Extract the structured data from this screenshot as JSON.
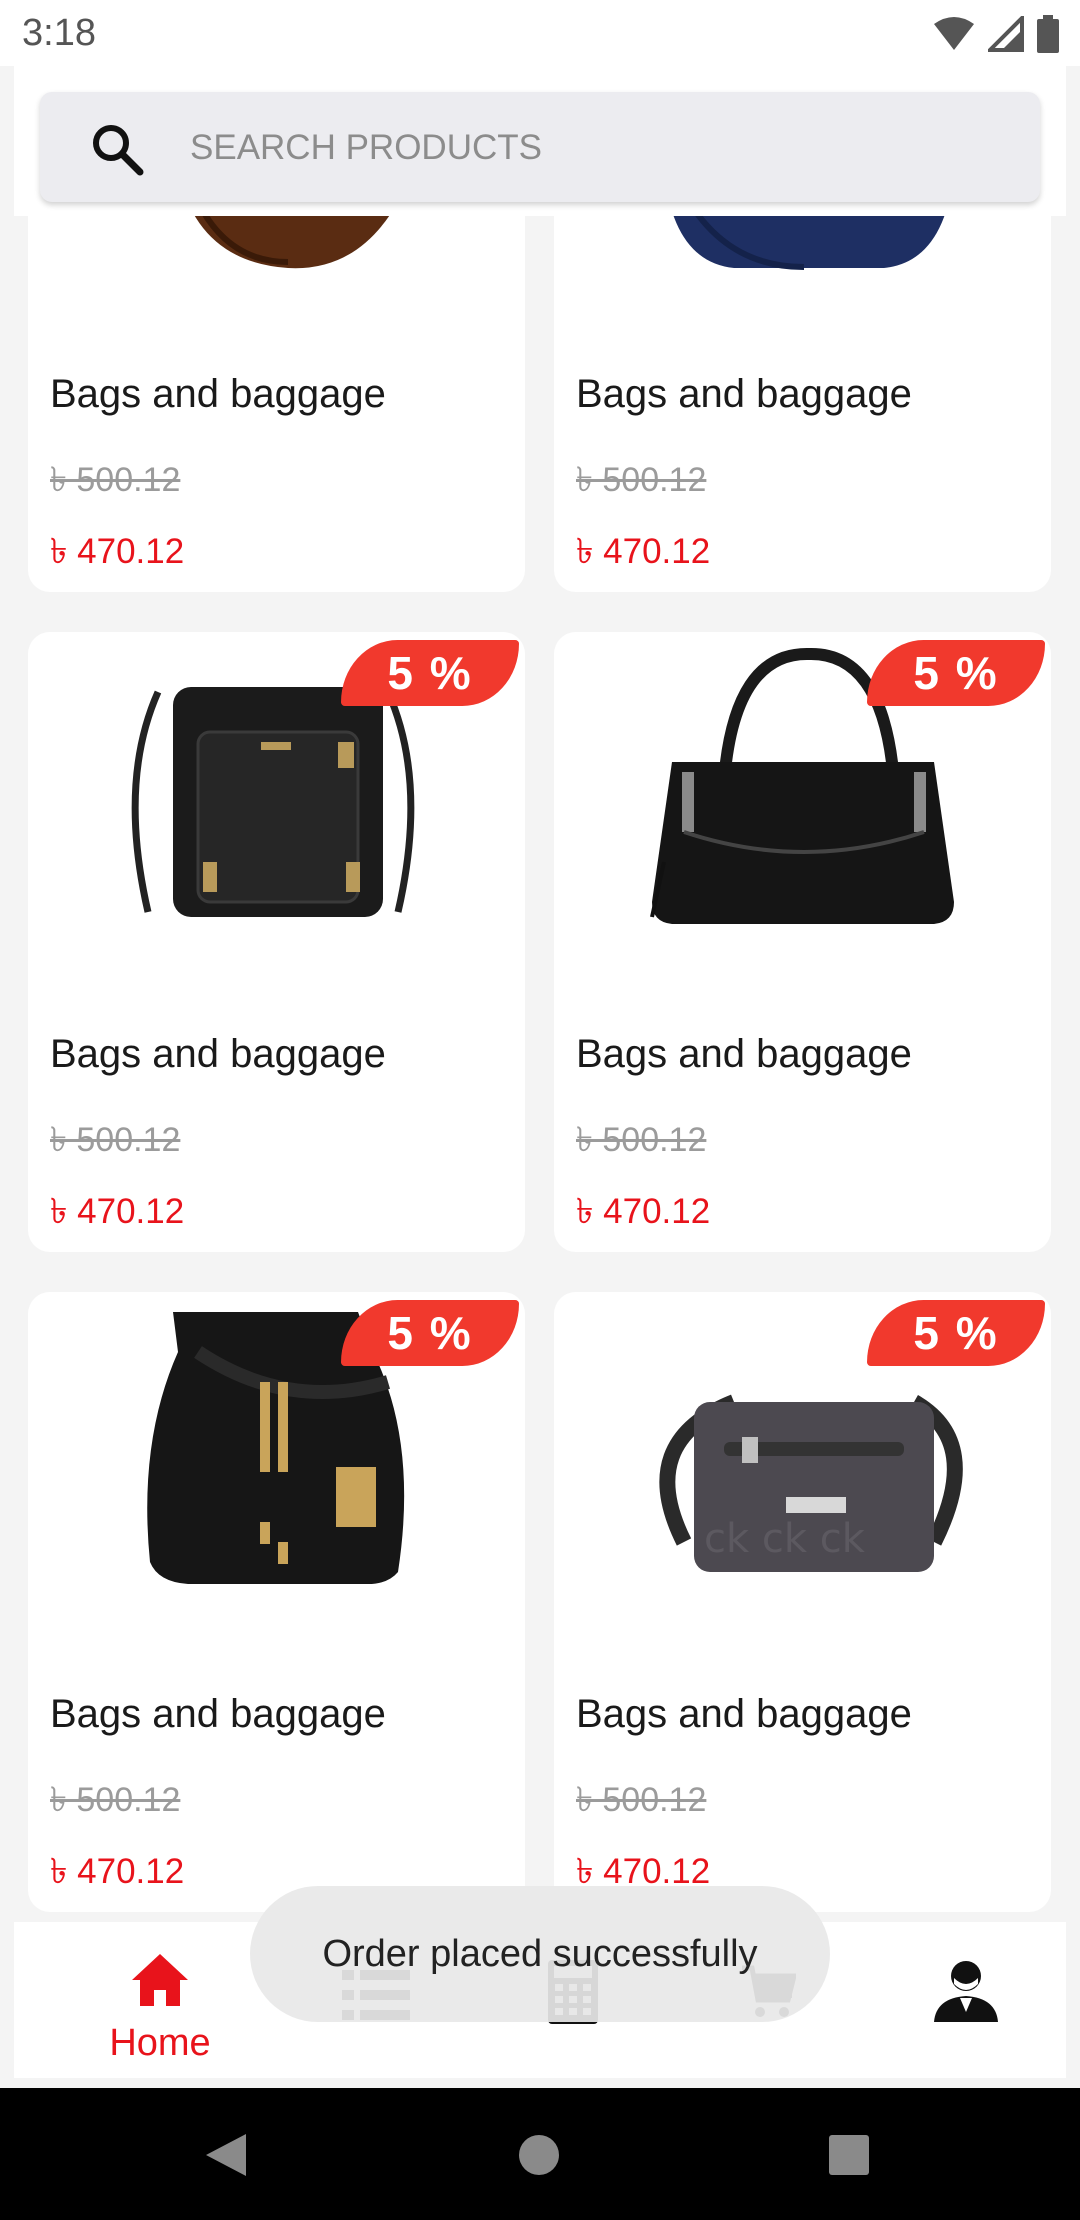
{
  "status_bar": {
    "time": "3:18"
  },
  "search": {
    "placeholder": "SEARCH PRODUCTS"
  },
  "products": [
    {
      "title": "Bags and baggage",
      "old_price": "৳ 500.12",
      "new_price": "৳ 470.12",
      "discount": ""
    },
    {
      "title": "Bags and baggage",
      "old_price": "৳ 500.12",
      "new_price": "৳ 470.12",
      "discount": ""
    },
    {
      "title": "Bags and baggage",
      "old_price": "৳ 500.12",
      "new_price": "৳ 470.12",
      "discount": "5 %"
    },
    {
      "title": "Bags and baggage",
      "old_price": "৳ 500.12",
      "new_price": "৳ 470.12",
      "discount": "5 %"
    },
    {
      "title": "Bags and baggage",
      "old_price": "৳ 500.12",
      "new_price": "৳ 470.12",
      "discount": "5 %"
    },
    {
      "title": "Bags and baggage",
      "old_price": "৳ 500.12",
      "new_price": "৳ 470.12",
      "discount": "5 %"
    }
  ],
  "bottom_nav": {
    "home_label": "Home",
    "items": [
      "home-icon",
      "list-icon",
      "calculator-icon",
      "cart-icon",
      "profile-icon"
    ]
  },
  "toast": {
    "message": "Order placed successfully"
  },
  "colors": {
    "accent": "#e8131b",
    "badge": "#f1392d",
    "old_price": "#9b9b9b"
  }
}
